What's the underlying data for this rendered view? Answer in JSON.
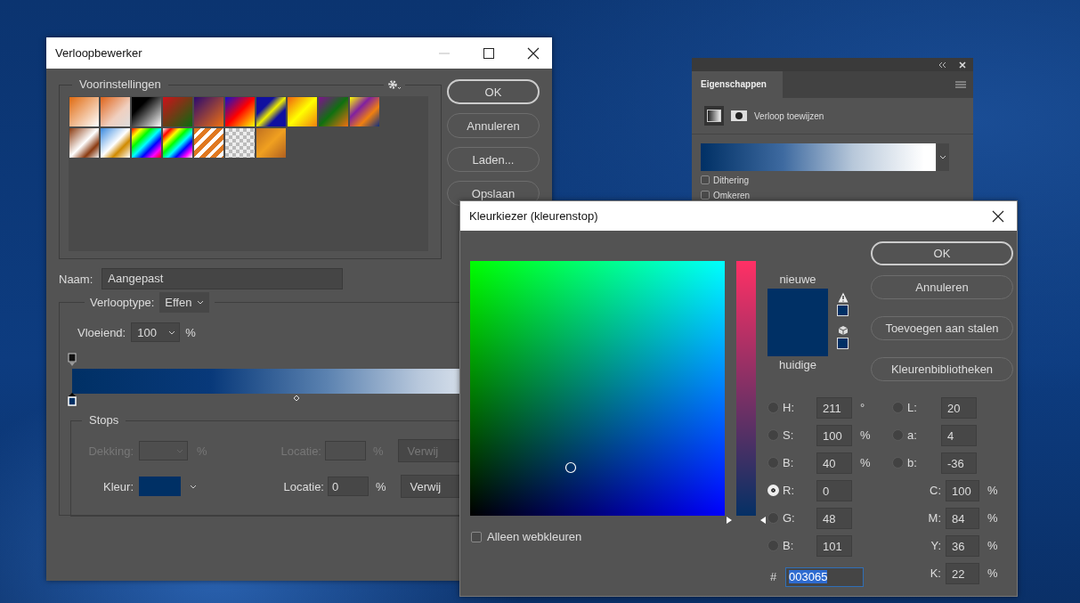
{
  "gradient_editor": {
    "title": "Verloopbewerker",
    "presets_label": "Voorinstellingen",
    "buttons": [
      "OK",
      "Annuleren",
      "Laden...",
      "Opslaan"
    ],
    "name_label": "Naam:",
    "name_value": "Aangepast",
    "type_label": "Verlooptype:",
    "type_value": "Effen",
    "smoothness_label": "Vloeiend:",
    "smoothness_value": "100",
    "smoothness_unit": "%",
    "stops_label": "Stops",
    "stop_rows": [
      {
        "kind": "opacity",
        "disabled": true,
        "label": "Dekking:",
        "unit": "%",
        "location_label": "Locatie:",
        "location_unit": "%",
        "delete_button": "Verwij"
      },
      {
        "kind": "color",
        "disabled": false,
        "label": "Kleur:",
        "color": "#003065",
        "location_label": "Locatie:",
        "location": "0",
        "location_unit": "%",
        "delete_button": "Verwij"
      }
    ]
  },
  "properties_panel": {
    "tab": "Eigenschappen",
    "heading": "Verloop toewijzen",
    "options": [
      {
        "label": "Dithering",
        "checked": false
      },
      {
        "label": "Omkeren",
        "checked": false
      }
    ]
  },
  "color_picker": {
    "title": "Kleurkiezer (kleurenstop)",
    "new_label": "nieuwe",
    "current_label": "huidige",
    "new_swatch": {
      "color": "#003065"
    },
    "current_swatch": {
      "color": "#003065"
    },
    "slider": {
      "level": 0
    },
    "buttons": [
      "OK",
      "Annuleren",
      "Toevoegen aan stalen",
      "Kleurenbibliotheken"
    ],
    "hsb_rgb_fields": [
      {
        "kind": "radio",
        "label": "H:",
        "value": "211",
        "unit": "°",
        "selected": false
      },
      {
        "kind": "radio",
        "label": "S:",
        "value": "100",
        "unit": "%",
        "selected": false
      },
      {
        "kind": "radio",
        "label": "B:",
        "value": "40",
        "unit": "%",
        "selected": false
      },
      {
        "kind": "radio",
        "label": "R:",
        "value": "0",
        "selected": true
      },
      {
        "kind": "radio",
        "label": "G:",
        "value": "48",
        "selected": false
      },
      {
        "kind": "radio",
        "label": "B:",
        "value": "101",
        "selected": false
      }
    ],
    "lab_cmyk_fields": [
      {
        "kind": "radio",
        "label": "L:",
        "value": "20",
        "selected": false
      },
      {
        "kind": "radio",
        "label": "a:",
        "value": "4",
        "selected": false
      },
      {
        "kind": "radio",
        "label": "b:",
        "value": "-36",
        "selected": false
      },
      {
        "kind": "plain",
        "label": "C:",
        "value": "100",
        "unit": "%"
      },
      {
        "kind": "plain",
        "label": "M:",
        "value": "84",
        "unit": "%"
      },
      {
        "kind": "plain",
        "label": "Y:",
        "value": "36",
        "unit": "%"
      },
      {
        "kind": "plain",
        "label": "K:",
        "value": "22",
        "unit": "%"
      }
    ],
    "hex_label": "#",
    "hex_value": "003065",
    "web_only": {
      "label": "Alleen webkleuren",
      "checked": false
    }
  }
}
